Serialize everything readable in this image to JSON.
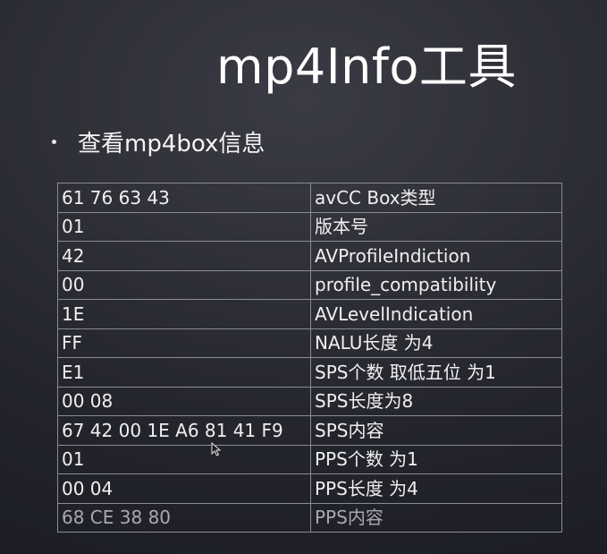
{
  "slide": {
    "title": "mp4Info工具",
    "bullet": "查看mp4box信息"
  },
  "table": {
    "rows": [
      {
        "hex": "61 76 63 43",
        "desc": "avCC Box类型"
      },
      {
        "hex": "01",
        "desc": "版本号"
      },
      {
        "hex": "42",
        "desc": "AVProfileIndiction"
      },
      {
        "hex": "00",
        "desc": "profile_compatibility"
      },
      {
        "hex": "1E",
        "desc": "AVLevelIndication"
      },
      {
        "hex": "FF",
        "desc": "NALU长度 为4"
      },
      {
        "hex": "E1",
        "desc": "SPS个数 取低五位 为1"
      },
      {
        "hex": "00 08",
        "desc": "SPS长度为8"
      },
      {
        "hex": "67 42 00 1E A6 81 41 F9",
        "desc": "SPS内容"
      },
      {
        "hex": "01",
        "desc": "PPS个数 为1"
      },
      {
        "hex": "00 04",
        "desc": "PPS长度 为4"
      },
      {
        "hex": "68 CE 38 80",
        "desc": "PPS内容"
      }
    ]
  }
}
